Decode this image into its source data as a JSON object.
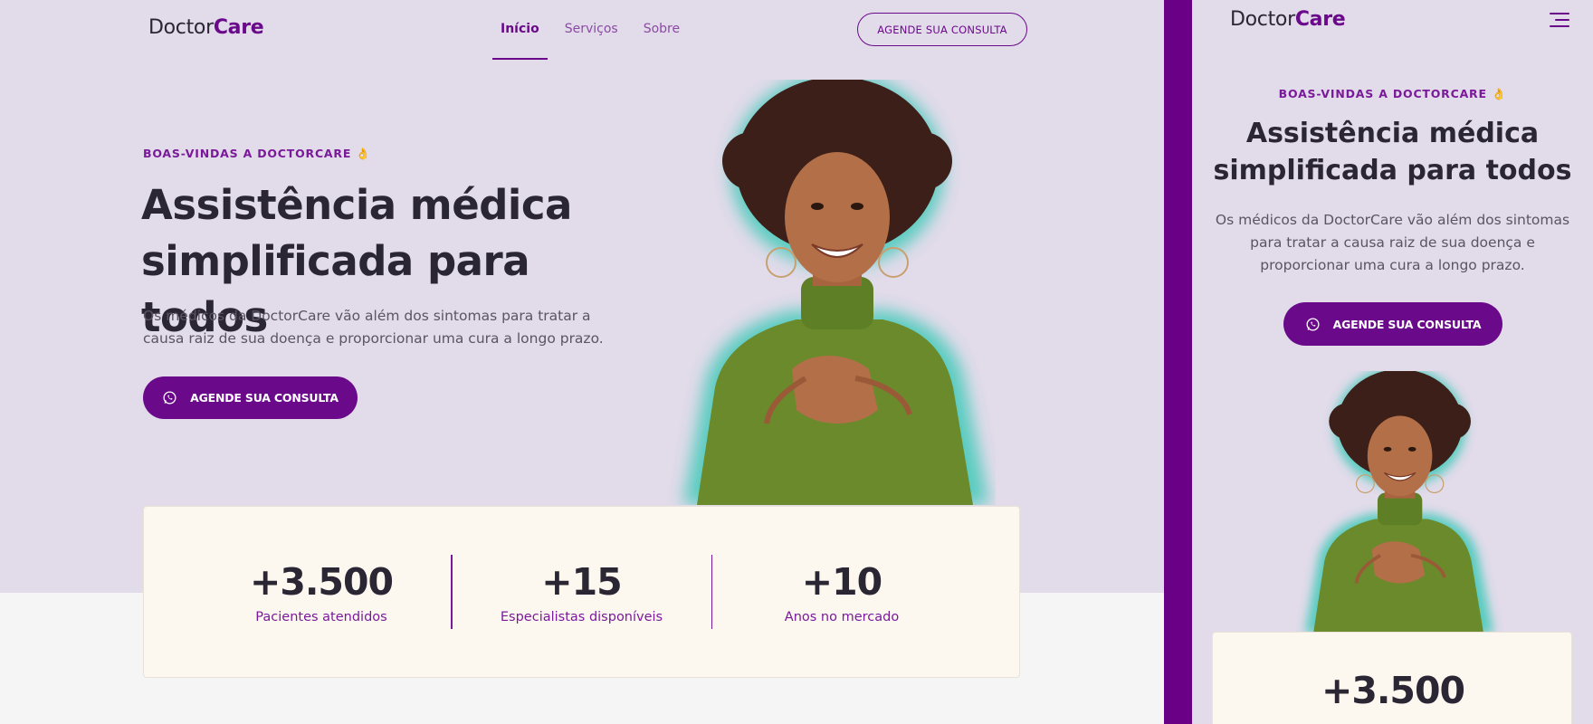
{
  "brand": {
    "logo_regular": "Doctor",
    "logo_bold": "Care"
  },
  "nav": {
    "items": [
      {
        "label": "Início",
        "active": true
      },
      {
        "label": "Serviços",
        "active": false
      },
      {
        "label": "Sobre",
        "active": false
      }
    ],
    "cta_label": "AGENDE SUA CONSULTA"
  },
  "hero": {
    "eyebrow": "BOAS-VINDAS A DOCTORCARE 👌",
    "title": "Assistência médica simplificada para todos",
    "subtitle": "Os médicos da DoctorCare vão além dos sintomas para tratar a causa raiz de sua doença e proporcionar uma cura a longo prazo.",
    "cta_label": "AGENDE SUA CONSULTA"
  },
  "stats": [
    {
      "number": "+3.500",
      "label": "Pacientes atendidos"
    },
    {
      "number": "+15",
      "label": "Especialistas disponíveis"
    },
    {
      "number": "+10",
      "label": "Anos no mercado"
    }
  ],
  "colors": {
    "primary": "#6a0a8a",
    "hero_bg": "#e2dbea",
    "stats_bg": "#fdf8ef",
    "separator": "#6a0085"
  },
  "icons": {
    "cta_icon": "whatsapp-icon",
    "menu_icon": "hamburger-menu-icon"
  }
}
